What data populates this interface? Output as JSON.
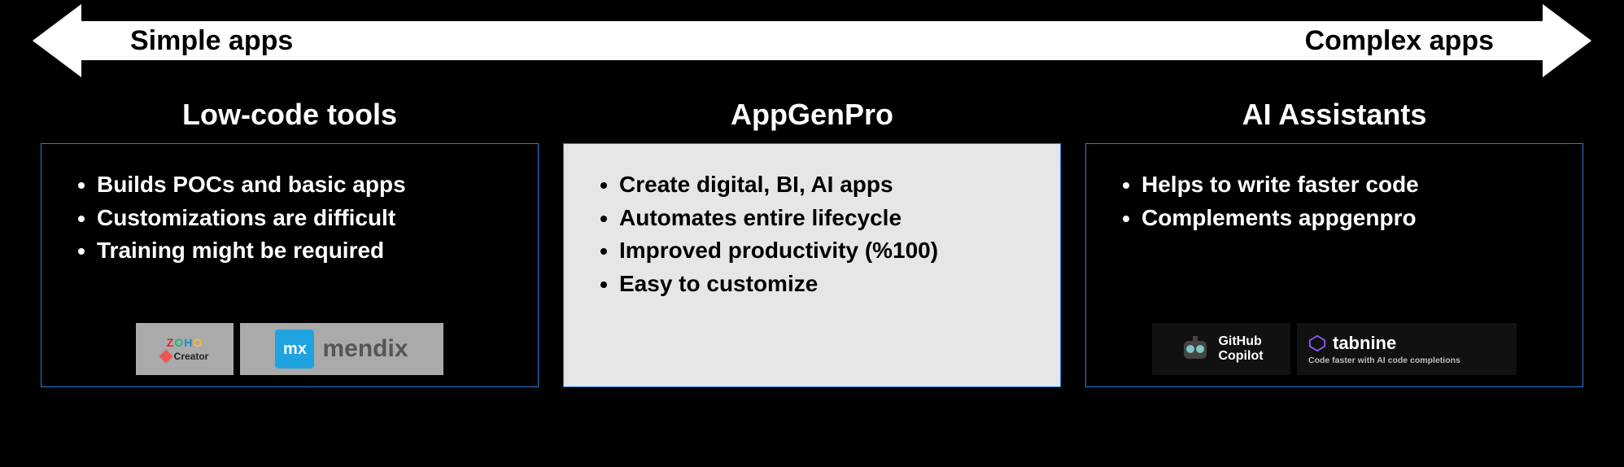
{
  "spectrum": {
    "left_label": "Simple apps",
    "right_label": "Complex apps"
  },
  "columns": [
    {
      "title": "Low-code tools",
      "bullets": [
        "Builds POCs and basic apps",
        "Customizations are difficult",
        "Training might be required"
      ],
      "logos": {
        "zoho_top": "ZOHO",
        "zoho_bottom": "Creator",
        "mendix_mx": "mx",
        "mendix_text": "mendix"
      }
    },
    {
      "title": "AppGenPro",
      "bullets": [
        "Create digital, BI, AI apps",
        "Automates entire lifecycle",
        "Improved productivity (%100)",
        "Easy to customize"
      ]
    },
    {
      "title": "AI Assistants",
      "bullets": [
        "Helps to write faster code",
        "Complements appgenpro"
      ],
      "logos": {
        "github_l1": "GitHub",
        "github_l2": "Copilot",
        "tabnine_name": "tabnine",
        "tabnine_sub": "Code faster with AI code completions"
      }
    }
  ]
}
